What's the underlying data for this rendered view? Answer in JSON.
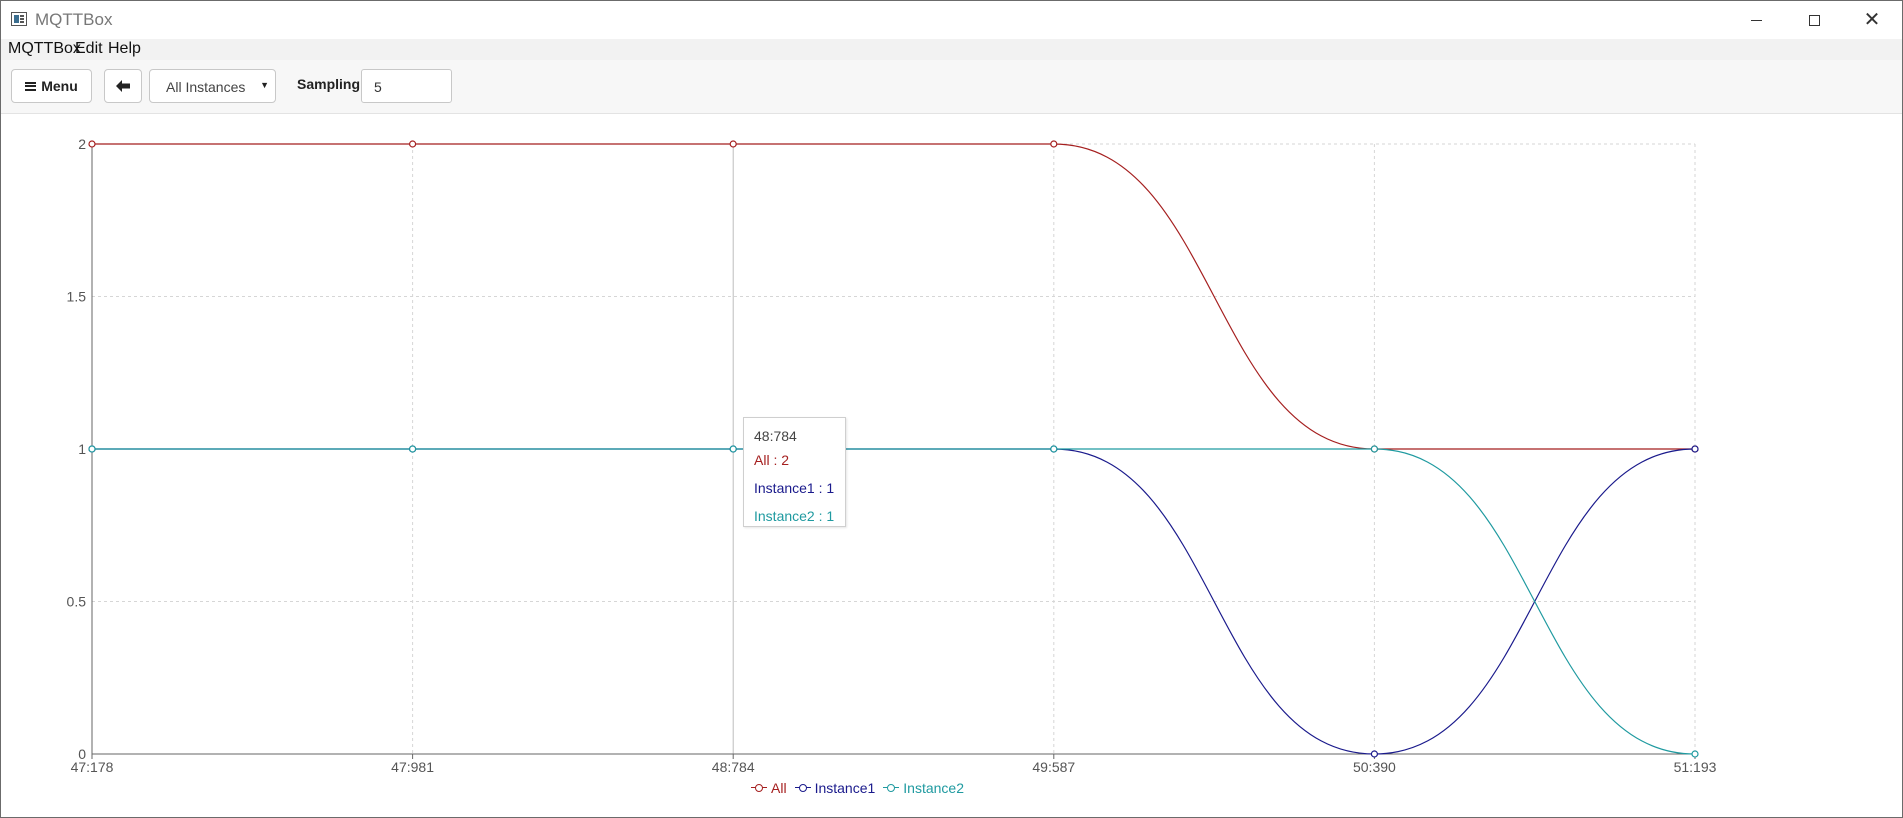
{
  "window": {
    "title": "MQTTBox",
    "controls": {
      "minimize": "minimize-icon",
      "maximize": "maximize-icon",
      "close": "close-icon"
    }
  },
  "menubar": {
    "items": [
      "MQTTBox",
      "Edit",
      "Help"
    ]
  },
  "toolbar": {
    "menu_label": "Menu",
    "back_icon": "arrow-left-icon",
    "instance_select": {
      "selected": "All Instances"
    },
    "sampling_label": "Sampling",
    "sampling_value": "5"
  },
  "tooltip": {
    "title": "48:784",
    "rows": [
      {
        "label": "All : 2",
        "color": "#a51f1f"
      },
      {
        "label": "Instance1 : 1",
        "color": "#1a1a8c"
      },
      {
        "label": "Instance2 : 1",
        "color": "#1f9aa0"
      }
    ]
  },
  "chart_data": {
    "type": "line",
    "categories": [
      "47:178",
      "47:981",
      "48:784",
      "49:587",
      "50:390",
      "51:193"
    ],
    "yticks": [
      "0",
      "0.5",
      "1",
      "1.5",
      "2"
    ],
    "ylim": [
      0,
      2
    ],
    "grid": true,
    "legend_position": "bottom-center",
    "series": [
      {
        "name": "All",
        "color": "#a51f1f",
        "values": [
          2,
          2,
          2,
          2,
          1,
          1
        ]
      },
      {
        "name": "Instance1",
        "color": "#1a1a8c",
        "values": [
          1,
          1,
          1,
          1,
          0,
          1
        ]
      },
      {
        "name": "Instance2",
        "color": "#1f9aa0",
        "values": [
          1,
          1,
          1,
          1,
          1,
          0
        ]
      }
    ],
    "highlighted_category": "48:784"
  }
}
